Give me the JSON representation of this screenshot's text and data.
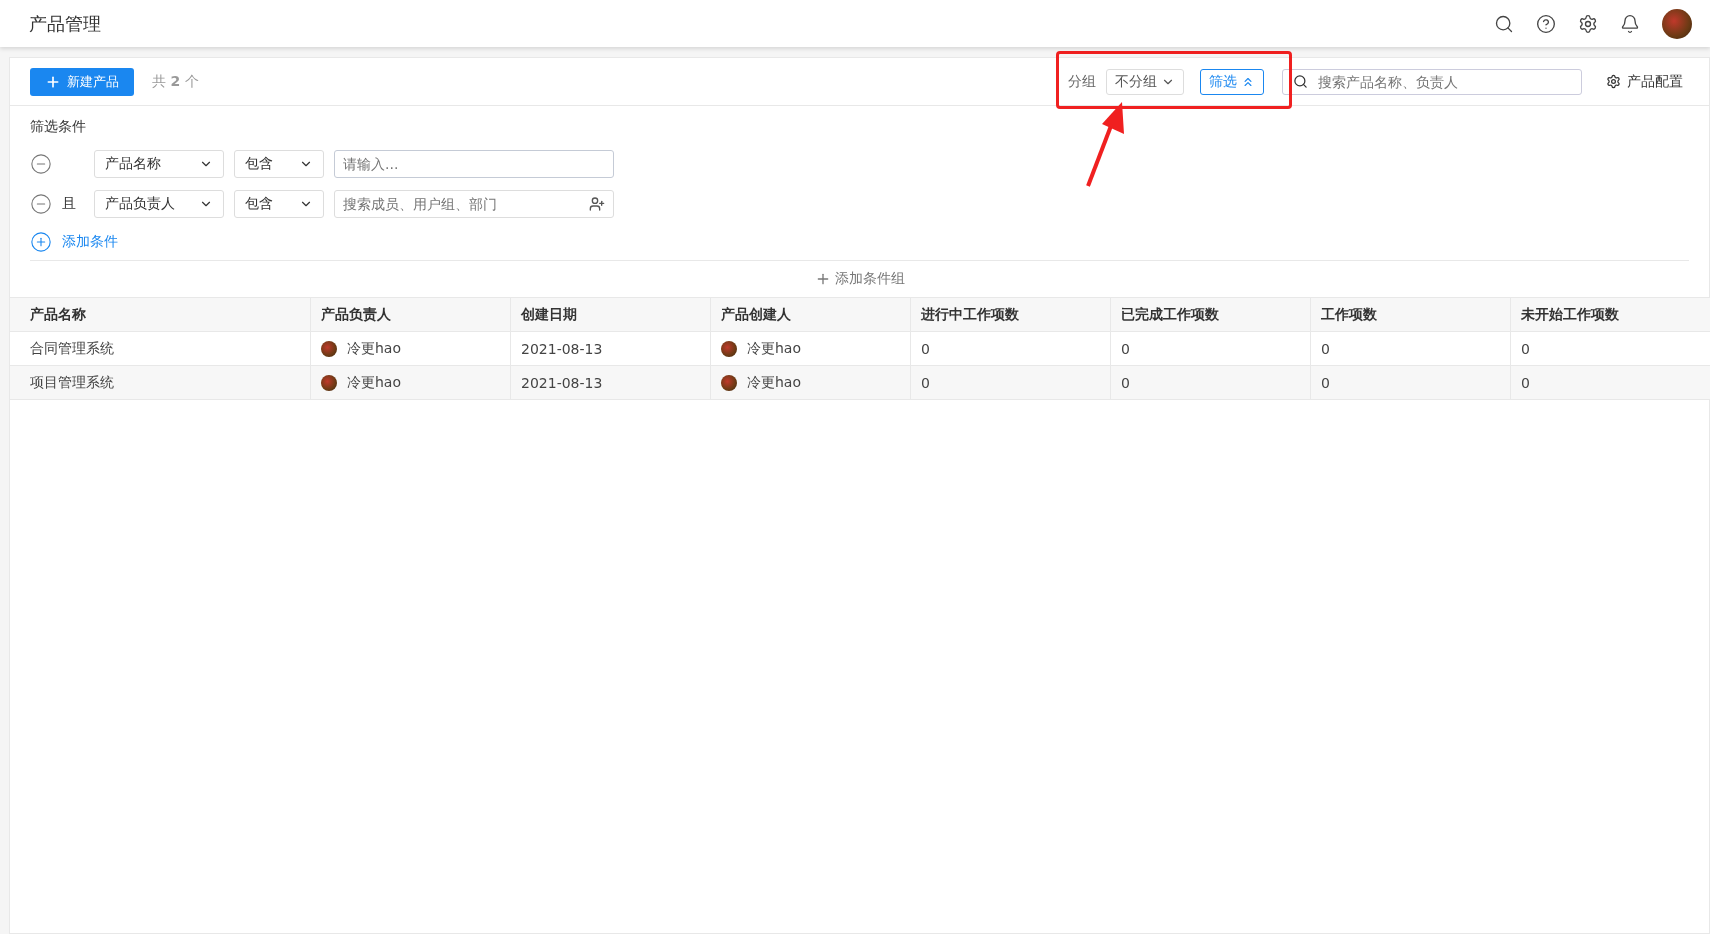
{
  "header": {
    "title": "产品管理"
  },
  "toolbar": {
    "create_button": "新建产品",
    "count_prefix": "共",
    "count": "2",
    "count_suffix": "个",
    "group_label": "分组",
    "group_value": "不分组",
    "filter_button": {
      "label": "筛选",
      "expanded": true
    },
    "search": {
      "placeholder": "搜索产品名称、负责人"
    },
    "config_button": "产品配置"
  },
  "filter": {
    "title": "筛选条件",
    "conditions": [
      {
        "field": "产品名称",
        "operator": "包含",
        "kind": "text",
        "placeholder": "请输入..."
      },
      {
        "connector": "且",
        "field": "产品负责人",
        "operator": "包含",
        "kind": "member",
        "placeholder": "搜索成员、用户组、部门"
      }
    ],
    "add_condition": "添加条件",
    "add_group": "添加条件组"
  },
  "table": {
    "columns": [
      "产品名称",
      "产品负责人",
      "创建日期",
      "产品创建人",
      "进行中工作项数",
      "已完成工作项数",
      "工作项数",
      "未开始工作项数"
    ],
    "rows": [
      {
        "name": "合同管理系统",
        "owner": "冷更hao",
        "date": "2021-08-13",
        "creator": "冷更hao",
        "in_progress": "0",
        "done": "0",
        "total": "0",
        "not_started": "0"
      },
      {
        "name": "项目管理系统",
        "owner": "冷更hao",
        "date": "2021-08-13",
        "creator": "冷更hao",
        "in_progress": "0",
        "done": "0",
        "total": "0",
        "not_started": "0"
      }
    ]
  }
}
